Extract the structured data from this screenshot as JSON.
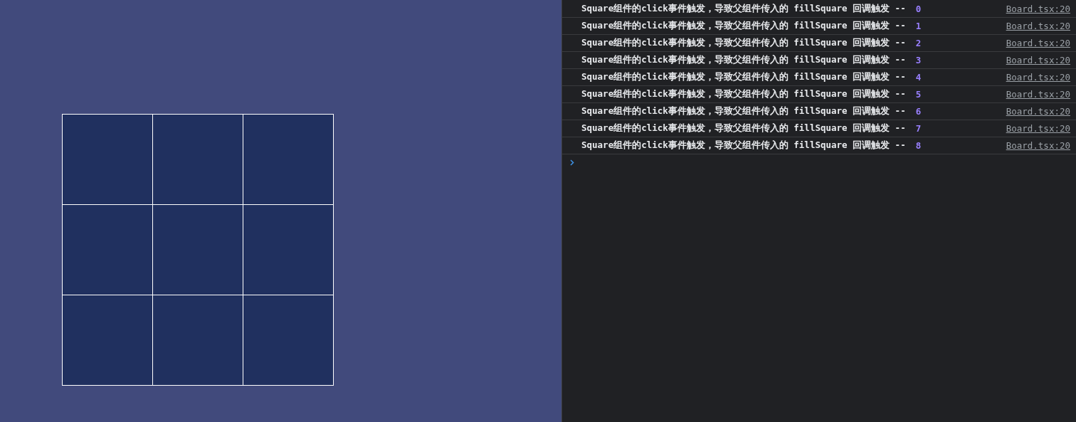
{
  "console": {
    "entries": [
      {
        "message": "Square组件的click事件触发，导致父组件传入的 fillSquare 回调触发 --",
        "value": "0",
        "source": "Board.tsx:20"
      },
      {
        "message": "Square组件的click事件触发，导致父组件传入的 fillSquare 回调触发 --",
        "value": "1",
        "source": "Board.tsx:20"
      },
      {
        "message": "Square组件的click事件触发，导致父组件传入的 fillSquare 回调触发 --",
        "value": "2",
        "source": "Board.tsx:20"
      },
      {
        "message": "Square组件的click事件触发，导致父组件传入的 fillSquare 回调触发 --",
        "value": "3",
        "source": "Board.tsx:20"
      },
      {
        "message": "Square组件的click事件触发，导致父组件传入的 fillSquare 回调触发 --",
        "value": "4",
        "source": "Board.tsx:20"
      },
      {
        "message": "Square组件的click事件触发，导致父组件传入的 fillSquare 回调触发 --",
        "value": "5",
        "source": "Board.tsx:20"
      },
      {
        "message": "Square组件的click事件触发，导致父组件传入的 fillSquare 回调触发 --",
        "value": "6",
        "source": "Board.tsx:20"
      },
      {
        "message": "Square组件的click事件触发，导致父组件传入的 fillSquare 回调触发 --",
        "value": "7",
        "source": "Board.tsx:20"
      },
      {
        "message": "Square组件的click事件触发，导致父组件传入的 fillSquare 回调触发 --",
        "value": "8",
        "source": "Board.tsx:20"
      }
    ]
  }
}
